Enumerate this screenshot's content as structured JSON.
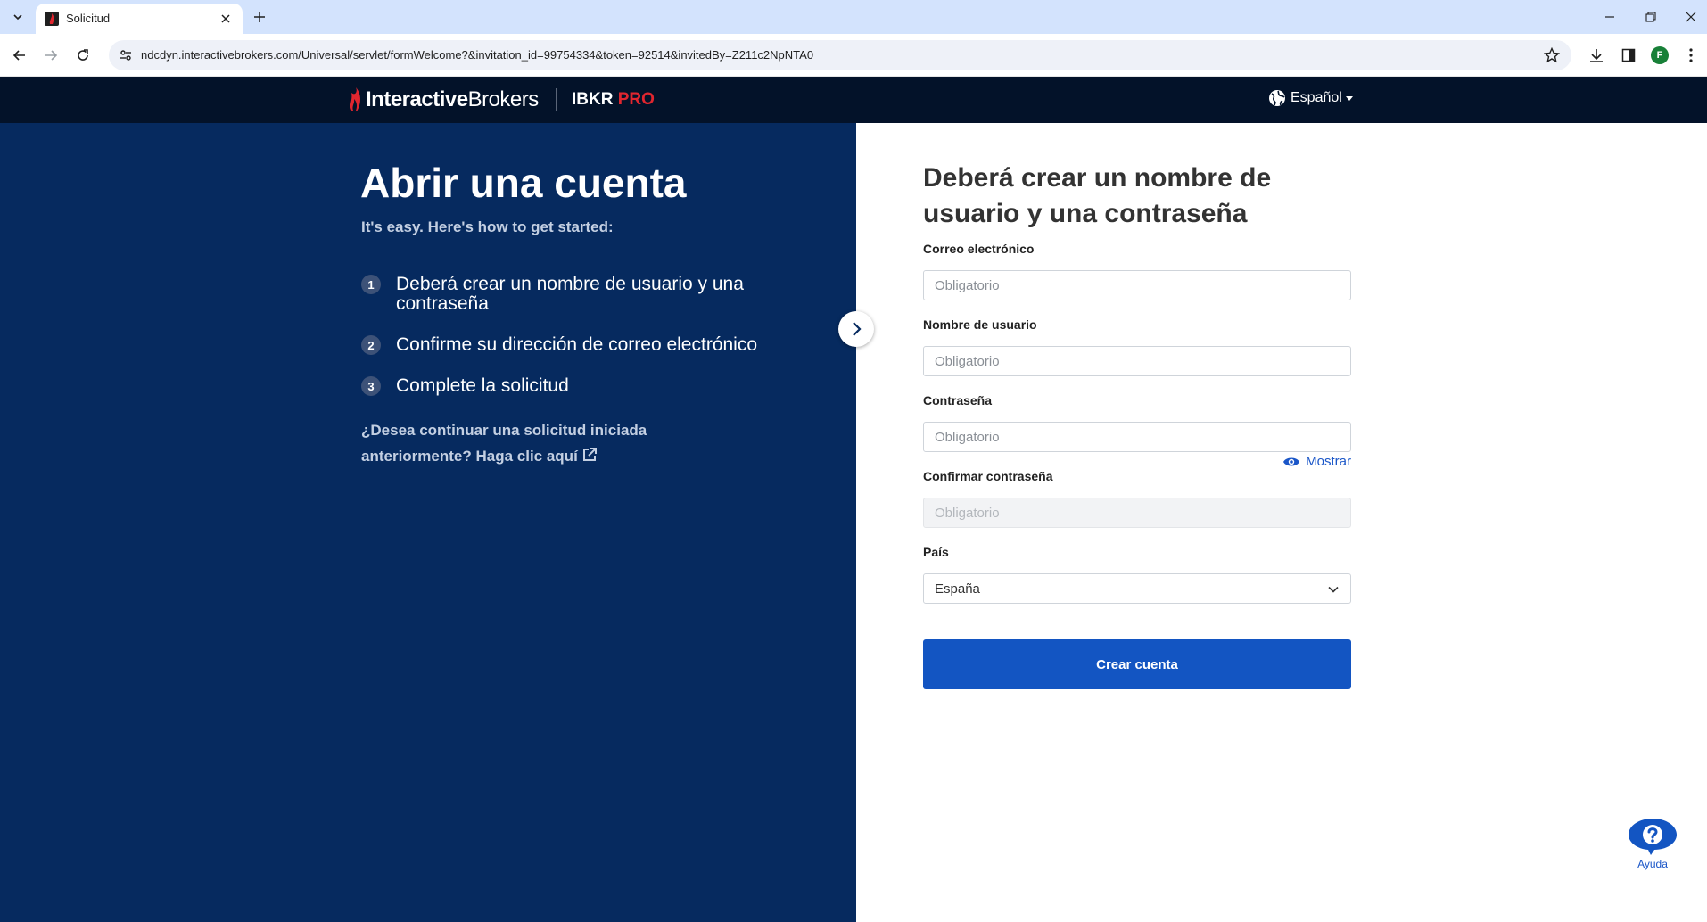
{
  "browser": {
    "tab_title": "Solicitud",
    "url": "ndcdyn.interactivebrokers.com/Universal/servlet/formWelcome?&invitation_id=99754334&token=92514&invitedBy=Z211c2NpNTA0",
    "profile_initial": "F"
  },
  "header": {
    "brand_bold": "Interactive",
    "brand_light": "Brokers",
    "product_main": "IBKR",
    "product_accent": "PRO",
    "language": "Español"
  },
  "left": {
    "heading": "Abrir una cuenta",
    "subheading": "It's easy. Here's how to get started:",
    "steps": [
      {
        "num": "1",
        "text": "Deberá crear un nombre de usuario y una contraseña"
      },
      {
        "num": "2",
        "text": "Confirme su dirección de correo electrónico"
      },
      {
        "num": "3",
        "text": "Complete la solicitud"
      }
    ],
    "continue_link": "¿Desea continuar una solicitud iniciada anteriormente? Haga clic aquí"
  },
  "form": {
    "title": "Deberá crear un nombre de usuario y una contraseña",
    "email_label": "Correo electrónico",
    "email_placeholder": "Obligatorio",
    "username_label": "Nombre de usuario",
    "username_placeholder": "Obligatorio",
    "password_label": "Contraseña",
    "password_placeholder": "Obligatorio",
    "show_password": "Mostrar",
    "confirm_label": "Confirmar contraseña",
    "confirm_placeholder": "Obligatorio",
    "country_label": "País",
    "country_value": "España",
    "submit_label": "Crear cuenta"
  },
  "help": {
    "label": "Ayuda"
  },
  "colors": {
    "header_bg": "#031229",
    "left_panel_bg": "#062a5f",
    "primary_button": "#1355c2",
    "accent_red": "#e0262f",
    "link_blue": "#1a56c8"
  }
}
